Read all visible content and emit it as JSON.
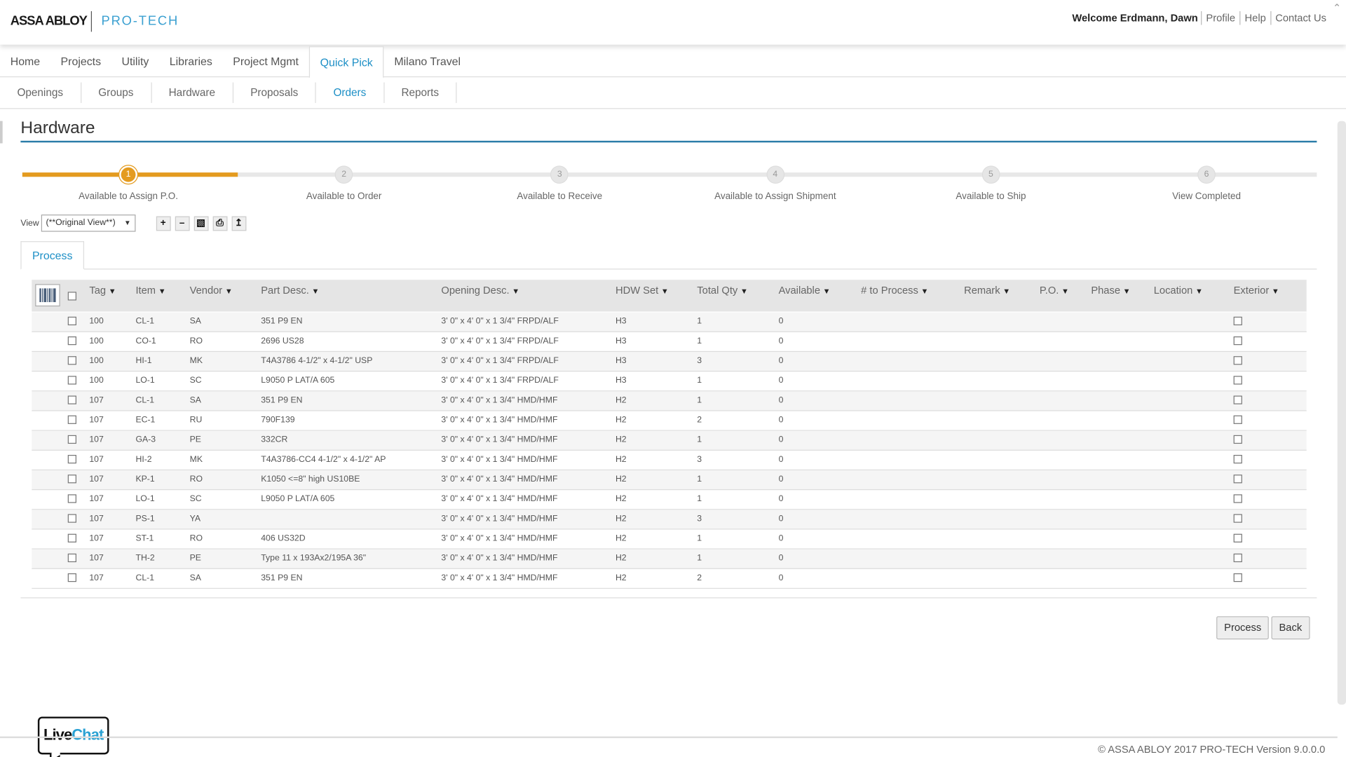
{
  "header": {
    "brand": "ASSA ABLOY",
    "product": "PRO-TECH",
    "welcome": "Welcome Erdmann, Dawn",
    "links": [
      "Profile",
      "Help",
      "Contact Us"
    ]
  },
  "main_nav": [
    "Home",
    "Projects",
    "Utility",
    "Libraries",
    "Project Mgmt",
    "Quick Pick",
    "Milano Travel"
  ],
  "main_nav_active": "Quick Pick",
  "sub_nav": [
    "Openings",
    "Groups",
    "Hardware",
    "Proposals",
    "Orders",
    "Reports"
  ],
  "sub_nav_active": "Orders",
  "page_title": "Hardware",
  "wizard": {
    "active": 1,
    "steps": [
      {
        "num": "1",
        "label": "Available to Assign P.O."
      },
      {
        "num": "2",
        "label": "Available to Order"
      },
      {
        "num": "3",
        "label": "Available to Receive"
      },
      {
        "num": "4",
        "label": "Available to Assign Shipment"
      },
      {
        "num": "5",
        "label": "Available to Ship"
      },
      {
        "num": "6",
        "label": "View Completed"
      }
    ]
  },
  "view": {
    "label": "View",
    "selected": "(**Original View**)"
  },
  "toolbar_icons": [
    "add-icon",
    "remove-icon",
    "save-icon",
    "print-icon",
    "export-icon"
  ],
  "tab": "Process",
  "table": {
    "columns": [
      "Tag",
      "Item",
      "Vendor",
      "Part Desc.",
      "Opening Desc.",
      "HDW Set",
      "Total Qty",
      "Available",
      "# to Process",
      "Remark",
      "P.O.",
      "Phase",
      "Location",
      "Exterior"
    ],
    "rows": [
      [
        "100",
        "CL-1",
        "SA",
        "351 P9 EN",
        "3' 0\" x 4' 0\" x 1 3/4\" FRPD/ALF",
        "H3",
        "1",
        "0"
      ],
      [
        "100",
        "CO-1",
        "RO",
        "2696 US28",
        "3' 0\" x 4' 0\" x 1 3/4\" FRPD/ALF",
        "H3",
        "1",
        "0"
      ],
      [
        "100",
        "HI-1",
        "MK",
        "T4A3786 4-1/2\" x 4-1/2\" USP",
        "3' 0\" x 4' 0\" x 1 3/4\" FRPD/ALF",
        "H3",
        "3",
        "0"
      ],
      [
        "100",
        "LO-1",
        "SC",
        "L9050 P LAT/A 605",
        "3' 0\" x 4' 0\" x 1 3/4\" FRPD/ALF",
        "H3",
        "1",
        "0"
      ],
      [
        "107",
        "CL-1",
        "SA",
        "351 P9 EN",
        "3' 0\" x 4' 0\" x 1 3/4\" HMD/HMF",
        "H2",
        "1",
        "0"
      ],
      [
        "107",
        "EC-1",
        "RU",
        "790F139",
        "3' 0\" x 4' 0\" x 1 3/4\" HMD/HMF",
        "H2",
        "2",
        "0"
      ],
      [
        "107",
        "GA-3",
        "PE",
        "332CR",
        "3' 0\" x 4' 0\" x 1 3/4\" HMD/HMF",
        "H2",
        "1",
        "0"
      ],
      [
        "107",
        "HI-2",
        "MK",
        "T4A3786-CC4 4-1/2\" x 4-1/2\" AP",
        "3' 0\" x 4' 0\" x 1 3/4\" HMD/HMF",
        "H2",
        "3",
        "0"
      ],
      [
        "107",
        "KP-1",
        "RO",
        "K1050 <=8\" high US10BE",
        "3' 0\" x 4' 0\" x 1 3/4\" HMD/HMF",
        "H2",
        "1",
        "0"
      ],
      [
        "107",
        "LO-1",
        "SC",
        "L9050 P LAT/A 605",
        "3' 0\" x 4' 0\" x 1 3/4\" HMD/HMF",
        "H2",
        "1",
        "0"
      ],
      [
        "107",
        "PS-1",
        "YA",
        "",
        "3' 0\" x 4' 0\" x 1 3/4\" HMD/HMF",
        "H2",
        "3",
        "0"
      ],
      [
        "107",
        "ST-1",
        "RO",
        "406 US32D",
        "3' 0\" x 4' 0\" x 1 3/4\" HMD/HMF",
        "H2",
        "1",
        "0"
      ],
      [
        "107",
        "TH-2",
        "PE",
        "Type 11 x 193Ax2/195A 36\"",
        "3' 0\" x 4' 0\" x 1 3/4\" HMD/HMF",
        "H2",
        "1",
        "0"
      ],
      [
        "107",
        "CL-1",
        "SA",
        "351 P9 EN",
        "3' 0\" x 4' 0\" x 1 3/4\" HMD/HMF",
        "H2",
        "2",
        "0"
      ]
    ]
  },
  "buttons": {
    "process": "Process",
    "back": "Back"
  },
  "livechat": {
    "live": "Live",
    "chat": "Chat"
  },
  "footer": "© ASSA ABLOY 2017 PRO-TECH Version 9.0.0.0",
  "colors": {
    "accent": "#1d8fc6",
    "step_active": "#e49b1f",
    "title_rule": "#2a7ca8"
  }
}
